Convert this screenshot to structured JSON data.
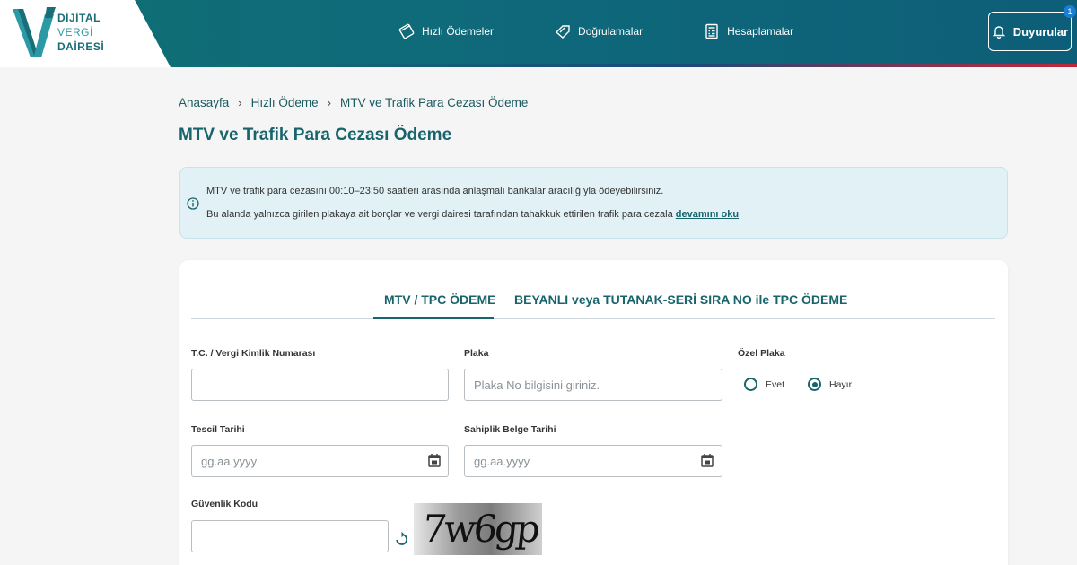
{
  "logo": {
    "line1": "DİJİTAL",
    "line2": "VERGİ",
    "line3": "DAİRESİ"
  },
  "nav": {
    "items": [
      {
        "label": "Hızlı Ödemeler",
        "icon": "card-icon"
      },
      {
        "label": "Doğrulamalar",
        "icon": "tag-icon"
      },
      {
        "label": "Hesaplamalar",
        "icon": "calculator-icon"
      }
    ]
  },
  "announcements": {
    "label": "Duyurular",
    "badge": "1"
  },
  "breadcrumb": {
    "items": [
      "Anasayfa",
      "Hızlı Ödeme",
      "MTV ve Trafik Para Cezası Ödeme"
    ]
  },
  "page": {
    "title": "MTV ve Trafik Para Cezası Ödeme"
  },
  "info": {
    "line1": "MTV ve trafik para cezasını 00:10–23:50 saatleri arasında anlaşmalı bankalar aracılığıyla ödeyebilirsiniz.",
    "line2": "Bu alanda yalnızca girilen plakaya ait borçlar ve vergi dairesi tarafından tahakkuk ettirilen trafik para cezala",
    "more_link": "devamını oku"
  },
  "tabs": [
    {
      "label": "MTV / TPC ÖDEME",
      "active": true
    },
    {
      "label": "BEYANLI veya TUTANAK-SERİ SIRA NO ile TPC ÖDEME",
      "active": false
    }
  ],
  "form": {
    "tckn": {
      "label": "T.C. / Vergi Kimlik Numarası",
      "value": "",
      "placeholder": ""
    },
    "plate": {
      "label": "Plaka",
      "value": "",
      "placeholder": "Plaka No bilgisini giriniz."
    },
    "special_plate": {
      "label": "Özel Plaka",
      "options": [
        "Evet",
        "Hayır"
      ],
      "selected": "Hayır"
    },
    "registration_date": {
      "label": "Tescil Tarihi",
      "placeholder": "gg.aa.yyyy"
    },
    "ownership_date": {
      "label": "Sahiplik Belge Tarihi",
      "placeholder": "gg.aa.yyyy"
    },
    "security_code": {
      "label": "Güvenlik Kodu",
      "value": "",
      "captcha": "7w6gp"
    }
  },
  "colors": {
    "primary": "#17646c",
    "header": "#0f6a7a",
    "info_bg": "#e1f1f6"
  }
}
